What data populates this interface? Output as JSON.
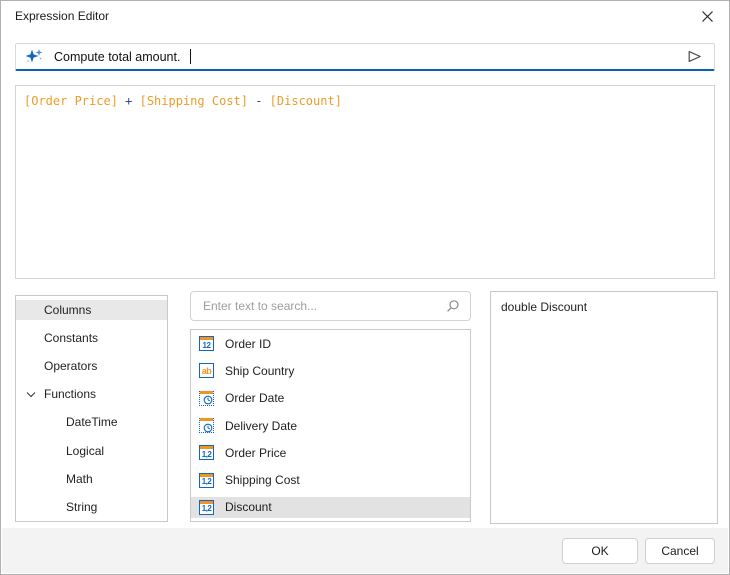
{
  "dialog": {
    "title": "Expression Editor"
  },
  "colors": {
    "accent_blue": "#0b62b0",
    "icon_blue": "#1565c0",
    "icon_orange": "#f29422",
    "expression_column": "#ed9c28",
    "expression_operator": "#2b4a8c",
    "selection_gray": "#e8e8e8"
  },
  "icons": {
    "prompt": "ai-sparkles-icon",
    "send": "send-icon",
    "close": "close-icon",
    "search": "magnifier-icon",
    "functions_expander": "chevron-down-icon"
  },
  "ai_prompt": {
    "value": "Compute total amount."
  },
  "expression": {
    "tokens": [
      "[Order Price]",
      " + ",
      "[Shipping Cost]",
      " - ",
      "[Discount]"
    ]
  },
  "tree": {
    "items": [
      {
        "label": "Columns",
        "selected": true,
        "level": 0
      },
      {
        "label": "Constants",
        "level": 0
      },
      {
        "label": "Operators",
        "level": 0
      },
      {
        "label": "Functions",
        "level": 0,
        "expanded": true
      },
      {
        "label": "DateTime",
        "level": 1
      },
      {
        "label": "Logical",
        "level": 1
      },
      {
        "label": "Math",
        "level": 1
      },
      {
        "label": "String",
        "level": 1
      }
    ]
  },
  "search": {
    "placeholder": "Enter text to search..."
  },
  "columns": {
    "items": [
      {
        "label": "Order ID",
        "icon": "integer-column-icon"
      },
      {
        "label": "Ship Country",
        "icon": "string-column-icon"
      },
      {
        "label": "Order Date",
        "icon": "date-column-icon"
      },
      {
        "label": "Delivery Date",
        "icon": "date-column-icon"
      },
      {
        "label": "Order Price",
        "icon": "numeric-column-icon"
      },
      {
        "label": "Shipping Cost",
        "icon": "numeric-column-icon"
      },
      {
        "label": "Discount",
        "icon": "numeric-column-icon",
        "selected": true
      }
    ]
  },
  "description": {
    "text": "double Discount"
  },
  "footer": {
    "ok_label": "OK",
    "cancel_label": "Cancel"
  }
}
